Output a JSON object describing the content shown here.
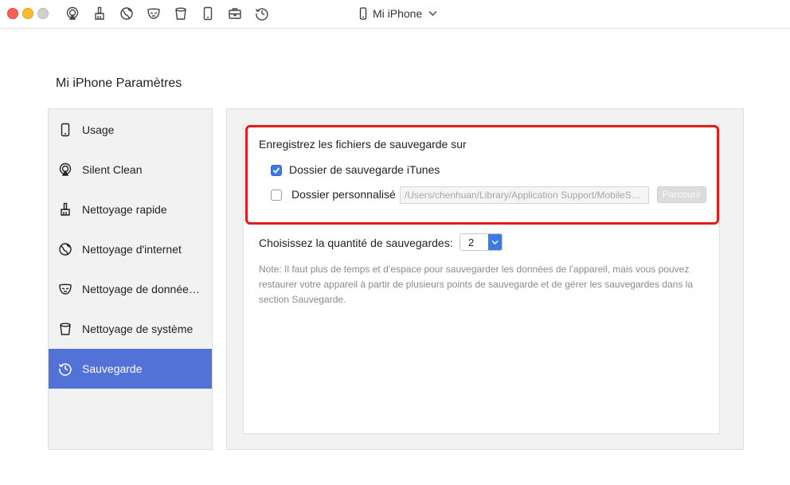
{
  "toolbar": {
    "icons": [
      "airplay-icon",
      "broom-icon",
      "globe-icon",
      "mask-icon",
      "trash-bin-icon",
      "phone-icon",
      "toolbox-icon",
      "history-clock-icon"
    ],
    "device_name": "Mi iPhone"
  },
  "page": {
    "title": "Mi iPhone Paramètres"
  },
  "sidebar": {
    "items": [
      {
        "label": "Usage",
        "icon": "phone-icon"
      },
      {
        "label": "Silent Clean",
        "icon": "airplay-icon"
      },
      {
        "label": "Nettoyage rapide",
        "icon": "broom-icon"
      },
      {
        "label": "Nettoyage d'internet",
        "icon": "globe-icon"
      },
      {
        "label": "Nettoyage de données privées",
        "icon": "mask-icon"
      },
      {
        "label": "Nettoyage de système",
        "icon": "trash-bin-icon"
      },
      {
        "label": "Sauvegarde",
        "icon": "history-clock-icon",
        "active": true
      }
    ]
  },
  "backup": {
    "section_title": "Enregistrez les fichiers de sauvegarde sur",
    "option_itunes": {
      "label": "Dossier de sauvegarde iTunes",
      "checked": true
    },
    "option_custom": {
      "label": "Dossier personnalisé",
      "checked": false
    },
    "path_value": "/Users/chenhuan/Library/Application Support/MobileSync/Backup",
    "browse_label": "Parcourir",
    "quantity_label": "Choisissez la quantité de sauvegardes:",
    "quantity_value": "2",
    "note": "Note: Il faut plus de temps et d’espace pour sauvegarder les données de l’appareil, mais vous pouvez restaurer votre appareil à partir de plusieurs points de sauvegarde et de gérer les sauvegardes dans la section Sauvegarde."
  },
  "colors": {
    "accent": "#5272d8",
    "checkbox": "#3d7ae8",
    "highlight": "#e01d1d"
  }
}
